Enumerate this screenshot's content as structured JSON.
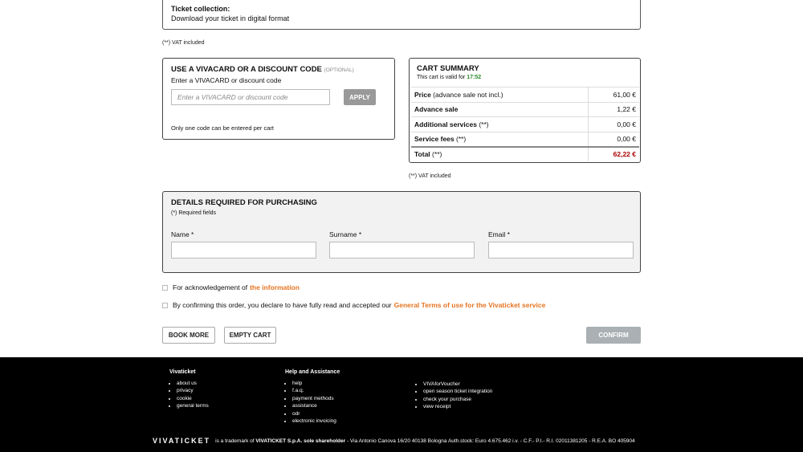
{
  "collection": {
    "title": "Ticket collection:",
    "text": "Download your ticket in digital format"
  },
  "vat_note": "(**) VAT included",
  "discount": {
    "title": "USE A VIVACARD OR A DISCOUNT CODE",
    "optional": "(OPTIONAL)",
    "subtitle": "Enter a VIVACARD or discount code",
    "placeholder": "Enter a VIVACARD or discount code",
    "apply_label": "APPLY",
    "note": "Only one code can be entered per cart"
  },
  "cart": {
    "title": "CART SUMMARY",
    "valid_text": "This cart is valid for",
    "valid_time": "17:52",
    "rows": [
      {
        "label": "Price",
        "suffix": " (advance sale not incl.)",
        "value": "61,00 €"
      },
      {
        "label": "Advance sale",
        "suffix": "",
        "value": "1,22 €"
      },
      {
        "label": "Additional services",
        "suffix": " (**)",
        "value": "0,00 €"
      },
      {
        "label": "Service fees",
        "suffix": " (**)",
        "value": "0,00 €"
      }
    ],
    "total": {
      "label": "Total",
      "suffix": " (**)",
      "value": "62,22 €"
    },
    "vat_note": "(**) VAT included"
  },
  "details": {
    "title": "DETAILS REQUIRED FOR PURCHASING",
    "required": "(*) Required fields",
    "fields": [
      {
        "label": "Name *"
      },
      {
        "label": "Surname *"
      },
      {
        "label": "Email *"
      }
    ]
  },
  "consents": {
    "info_text": "For acknowledgement of",
    "info_link": "the information",
    "terms_text": "By confirming this order, you declare to have fully read and accepted our",
    "terms_link": "General Terms of use for the Vivaticket service"
  },
  "buttons": {
    "book_more": "BOOK MORE",
    "empty_cart": "EMPTY CART",
    "confirm": "CONFIRM"
  },
  "footer": {
    "col1": {
      "title": "Vivaticket",
      "items": [
        "about us",
        "privacy",
        "cookie",
        "general terms"
      ]
    },
    "col2": {
      "title": "Help and Assistance",
      "items": [
        "help",
        "f.a.q.",
        "payment methods",
        "assistance",
        "odr",
        "electronic invoicing"
      ]
    },
    "col3": {
      "items": [
        "VIVAforVoucher",
        "open season ticket integration",
        "check your purchase",
        "view receipt"
      ]
    },
    "logo": "VIVATICKET",
    "trademark_pre": "is a trademark of",
    "trademark_company": "VIVATICKET S.p.A. sole shareholder",
    "trademark_post": "- Via Antonio Canova 16/20 40138 Bologna Auth.stock: Euro 4.675.462 i.v. - C.F.- P.I.- R.I. 02011381205 - R.E.A. BO 405904"
  },
  "colors": {
    "accent_orange": "#e5731f",
    "valid_green": "#2a8a2a",
    "total_red": "#aa0000",
    "confirm_disabled": "#aab0b3"
  }
}
